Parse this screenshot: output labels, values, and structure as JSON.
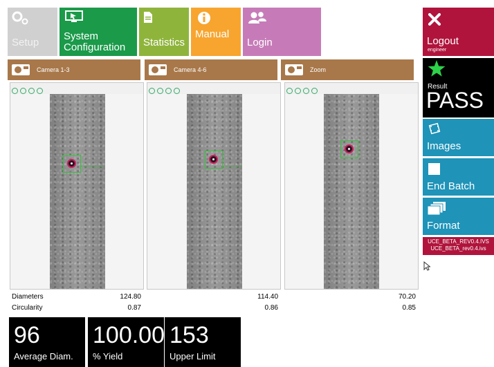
{
  "nav": {
    "setup": "Setup",
    "system_configuration": "System\nConfiguration",
    "statistics": "Statistics",
    "manual": "Manual",
    "login": "Login"
  },
  "cameras": [
    {
      "label": "Camera 1-3"
    },
    {
      "label": "Camera 4-6"
    },
    {
      "label": "Zoom"
    }
  ],
  "measurements": {
    "diameters_label": "Diameters",
    "circularity_label": "Circularity",
    "diameters": [
      "124.80",
      "114.40",
      "70.20"
    ],
    "circularity": [
      "0.87",
      "0.86",
      "0.85"
    ]
  },
  "stats": [
    {
      "value": "96",
      "label": "Average Diam."
    },
    {
      "value": "100.00",
      "label": "% Yield"
    },
    {
      "value": "153",
      "label": "Upper Limit"
    }
  ],
  "side": {
    "logout": "Logout",
    "user": "engineer",
    "result_label": "Result",
    "result_value": "PASS",
    "images": "Images",
    "end_batch": "End Batch",
    "format": "Format",
    "files": [
      "UCE_BETA_REV0.4.IVS",
      "UCE_BETA_rev0.4.ivs"
    ]
  },
  "colors": {
    "setup": "#c8c8c8",
    "system_configuration": "#1b9a4a",
    "statistics": "#8fb43c",
    "manual": "#f7a52f",
    "login": "#c67bb8",
    "camera_header": "#a8784a",
    "logout": "#b0143c",
    "result": "#000000",
    "images": "#1f93b8",
    "end_batch": "#1f93b8",
    "format": "#1f93b8",
    "files": "#b0143c"
  }
}
